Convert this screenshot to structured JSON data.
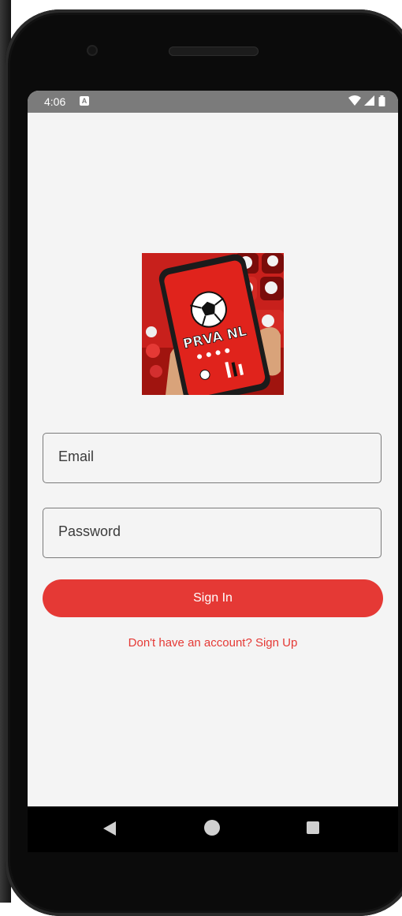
{
  "status_bar": {
    "time": "4:06",
    "notification_icon": "a-icon",
    "icons": [
      "wifi-icon",
      "signal-icon",
      "battery-icon"
    ]
  },
  "logo": {
    "brand_text": "PRVA NL"
  },
  "form": {
    "email_label": "Email",
    "password_label": "Password",
    "signin_label": "Sign In",
    "signup_text": "Don't have an account? Sign Up"
  },
  "nav": {
    "icons": [
      "back-icon",
      "home-icon",
      "recents-icon"
    ]
  },
  "colors": {
    "accent": "#e53935",
    "status_bar": "#7b7b7b",
    "screen_background": "#f4f4f4"
  }
}
